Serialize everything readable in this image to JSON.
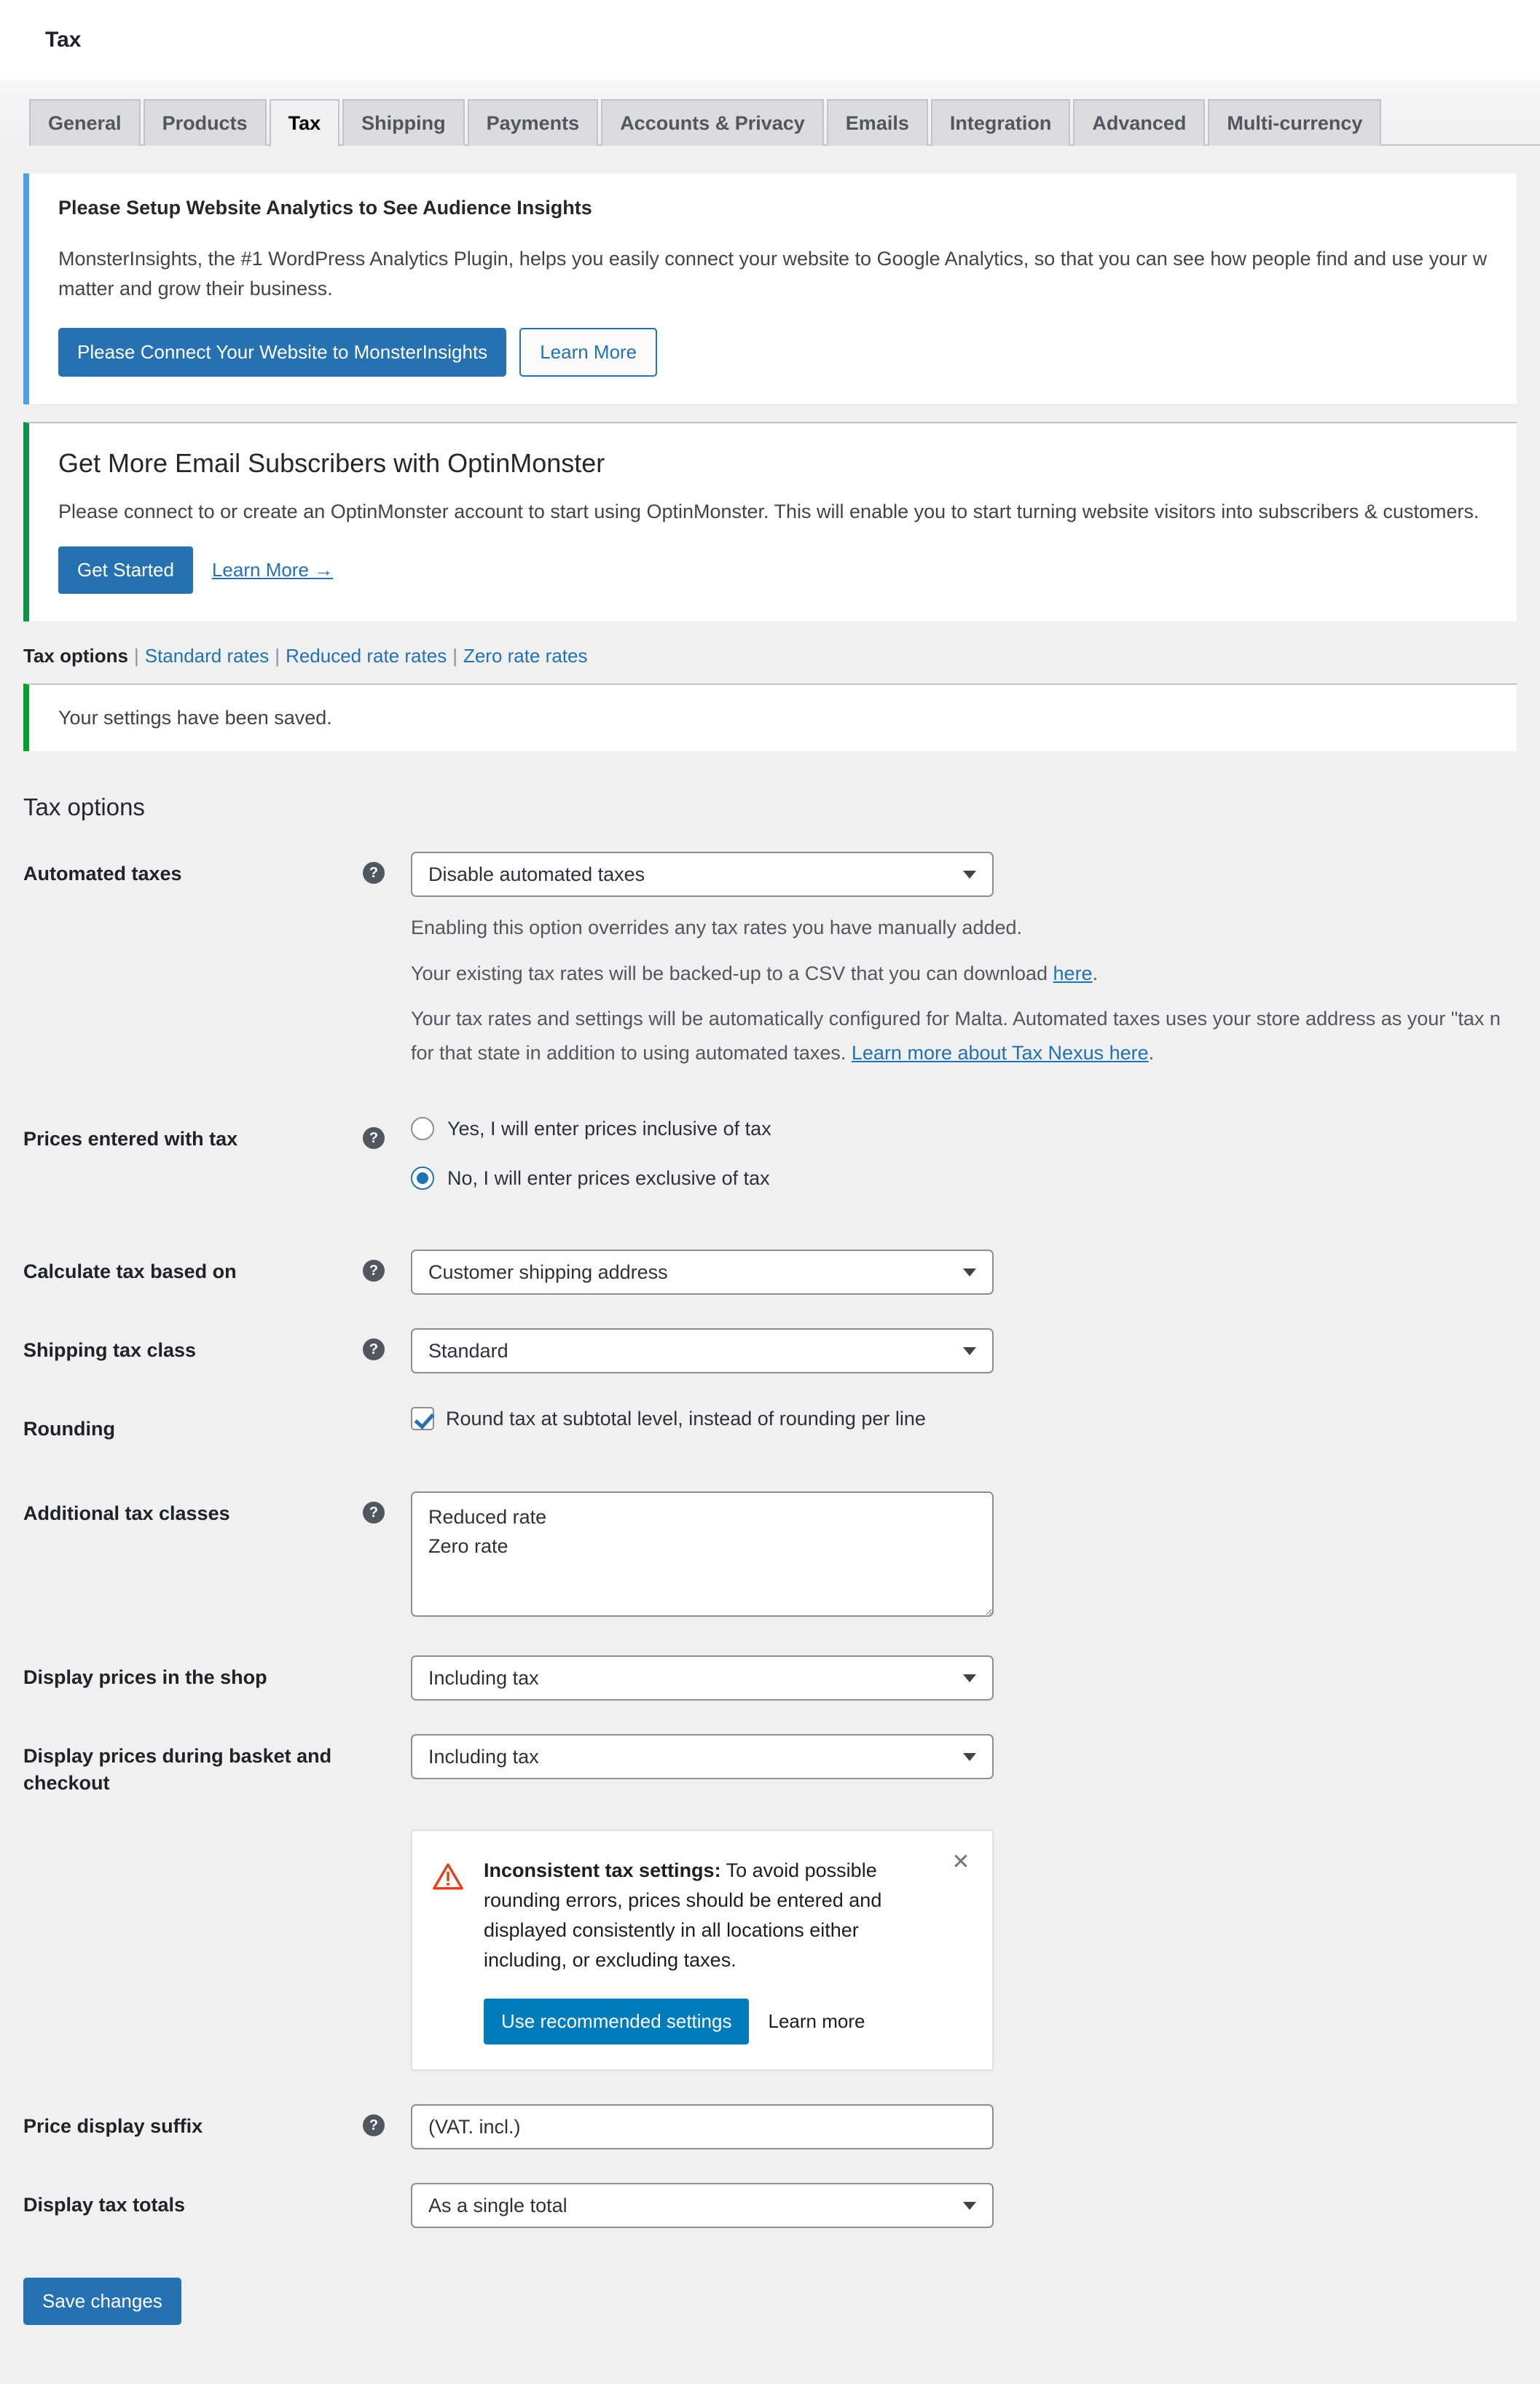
{
  "header": {
    "page_title": "Tax"
  },
  "tabs": [
    {
      "label": "General",
      "active": false
    },
    {
      "label": "Products",
      "active": false
    },
    {
      "label": "Tax",
      "active": true
    },
    {
      "label": "Shipping",
      "active": false
    },
    {
      "label": "Payments",
      "active": false
    },
    {
      "label": "Accounts & Privacy",
      "active": false
    },
    {
      "label": "Emails",
      "active": false
    },
    {
      "label": "Integration",
      "active": false
    },
    {
      "label": "Advanced",
      "active": false
    },
    {
      "label": "Multi-currency",
      "active": false
    }
  ],
  "monsterinsights_notice": {
    "title": "Please Setup Website Analytics to See Audience Insights",
    "body_line1": "MonsterInsights, the #1 WordPress Analytics Plugin, helps you easily connect your website to Google Analytics, so that you can see how people find and use your website",
    "body_line2": "matter and grow their business.",
    "primary_button": "Please Connect Your Website to MonsterInsights",
    "secondary_button": "Learn More"
  },
  "optinmonster_notice": {
    "title": "Get More Email Subscribers with OptinMonster",
    "body": "Please connect to or create an OptinMonster account to start using OptinMonster. This will enable you to start turning website visitors into subscribers & customers.",
    "primary_button": "Get Started",
    "learn_more": "Learn More →"
  },
  "subnav": {
    "current": "Tax options",
    "links": [
      "Standard rates",
      "Reduced rate rates",
      "Zero rate rates"
    ]
  },
  "saved_notice": {
    "text": "Your settings have been saved."
  },
  "section": {
    "heading": "Tax options"
  },
  "fields": {
    "automated_taxes": {
      "label": "Automated taxes",
      "value": "Disable automated taxes",
      "desc1": "Enabling this option overrides any tax rates you have manually added.",
      "desc2_pre": "Your existing tax rates will be backed-up to a CSV that you can download ",
      "desc2_link": "here",
      "desc2_post": ".",
      "desc3_line1": "Your tax rates and settings will be automatically configured for Malta. Automated taxes uses your store address as your \"tax n",
      "desc3_line2_pre": "for that state in addition to using automated taxes. ",
      "desc3_link": "Learn more about Tax Nexus here",
      "desc3_post": "."
    },
    "prices_entered_with_tax": {
      "label": "Prices entered with tax",
      "option_yes": "Yes, I will enter prices inclusive of tax",
      "option_no": "No, I will enter prices exclusive of tax",
      "selected": "no"
    },
    "calculate_tax_based_on": {
      "label": "Calculate tax based on",
      "value": "Customer shipping address"
    },
    "shipping_tax_class": {
      "label": "Shipping tax class",
      "value": "Standard"
    },
    "rounding": {
      "label": "Rounding",
      "checkbox_label": "Round tax at subtotal level, instead of rounding per line",
      "checked": true
    },
    "additional_tax_classes": {
      "label": "Additional tax classes",
      "value": "Reduced rate\nZero rate"
    },
    "display_prices_shop": {
      "label": "Display prices in the shop",
      "value": "Including tax"
    },
    "display_prices_checkout": {
      "label": "Display prices during basket and checkout",
      "value": "Including tax"
    },
    "price_display_suffix": {
      "label": "Price display suffix",
      "value": "(VAT. incl.)"
    },
    "display_tax_totals": {
      "label": "Display tax totals",
      "value": "As a single total"
    }
  },
  "warning_card": {
    "title": "Inconsistent tax settings:",
    "body": " To avoid possible rounding errors, prices should be entered and displayed consistently in all locations either including, or excluding taxes.",
    "primary_button": "Use recommended settings",
    "learn_more": "Learn more",
    "close_glyph": "✕"
  },
  "save_button": {
    "label": "Save changes"
  },
  "colors": {
    "wp_blue": "#2571b1",
    "wc_blue": "#007cba",
    "link_blue": "#2271b1",
    "success_green": "#00a32a",
    "optin_green": "#0b9444",
    "mi_border_blue": "#509fe2",
    "warn_red": "#e2401c",
    "page_bg": "#f0f0f1"
  }
}
